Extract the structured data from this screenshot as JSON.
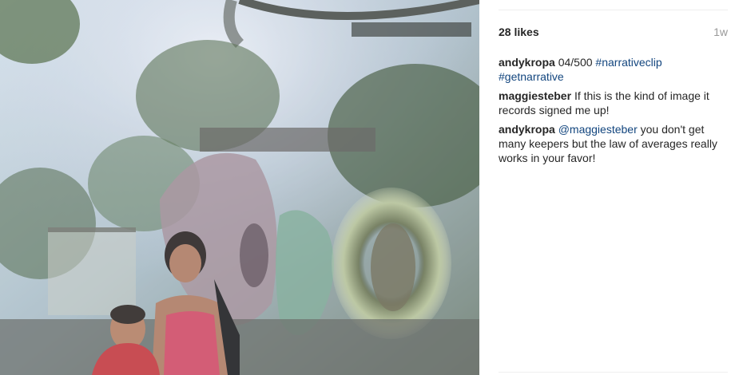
{
  "photo": {
    "alt": ""
  },
  "post": {
    "likes": "28 likes",
    "time_ago": "1w"
  },
  "comments": [
    {
      "username": "andykropa",
      "parts": [
        {
          "type": "text",
          "value": "04/500"
        },
        {
          "type": "tag",
          "value": "#narrativeclip"
        },
        {
          "type": "tag",
          "value": "#getnarrative"
        }
      ]
    },
    {
      "username": "maggiesteber",
      "parts": [
        {
          "type": "text",
          "value": "If this is the kind of image it records signed me up!"
        }
      ]
    },
    {
      "username": "andykropa",
      "parts": [
        {
          "type": "mention",
          "value": "@maggiesteber"
        },
        {
          "type": "text",
          "value": "you don't get many keepers but the law of averages really works in your favor!"
        }
      ]
    }
  ],
  "colors": {
    "link": "#12457e",
    "timestamp": "#999999",
    "divider": "#efefef"
  }
}
